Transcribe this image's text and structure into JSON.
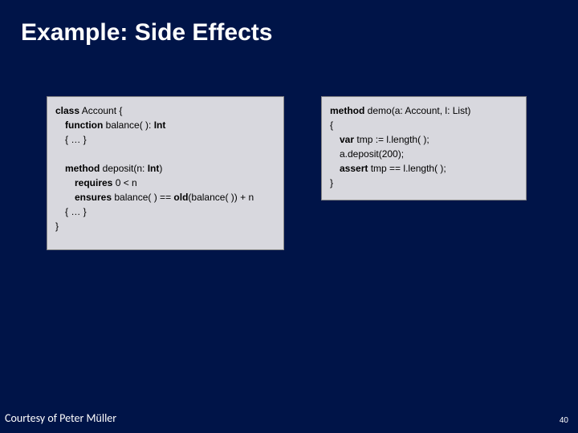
{
  "slide": {
    "title": "Example: Side Effects",
    "footer_left": "Courtesy of Peter Müller",
    "page_number": "40"
  },
  "left_code": {
    "l1a": "class",
    "l1b": " Account {",
    "l2a": "function",
    "l2b": " balance( ): ",
    "l2c": "Int",
    "l3": "{ … }",
    "l4a": "method",
    "l4b": " deposit(n: ",
    "l4c": "Int",
    "l4d": ")",
    "l5a": "requires",
    "l5b": " 0 < n",
    "l6a": "ensures",
    "l6b": " balance( ) == ",
    "l6c": "old",
    "l6d": "(balance( )) + n",
    "l7": "{ … }",
    "l8": "}"
  },
  "right_code": {
    "l1a": "method",
    "l1b": " demo(a: Account, l: List)",
    "l2": "{",
    "l3a": "var",
    "l3b": " tmp := l.length( );",
    "l4": "a.deposit(200);",
    "l5a": "assert",
    "l5b": " tmp == l.length( );",
    "l6": "}"
  }
}
